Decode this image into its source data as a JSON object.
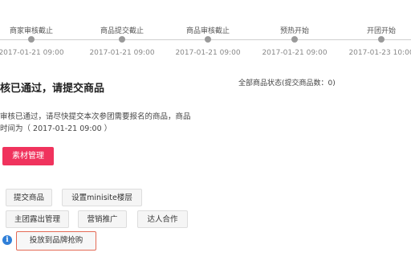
{
  "timeline": {
    "steps": [
      {
        "label": "商家审核截止",
        "date": "2017-01-21 09:00"
      },
      {
        "label": "商品提交截止",
        "date": "2017-01-21 09:00"
      },
      {
        "label": "商品审核截止",
        "date": "2017-01-21 09:00"
      },
      {
        "label": "预热开始",
        "date": "2017-01-21 09:00"
      },
      {
        "label": "开团开始",
        "date": "2017-01-23 10:00"
      }
    ]
  },
  "status": {
    "title": "核已通过，请提交商品",
    "summary": "全部商品状态(提交商品数：0)",
    "desc_line1": "审核已通过，请尽快提交本次参团需要报名的商品，商品",
    "desc_line2": "时间为（ 2017-01-21 09:00 ）"
  },
  "actions": {
    "material_button": "素材管理",
    "submit_goods": "提交商品",
    "minisite_floor": "设置minisite楼层",
    "main_exposure": "主团露出管理",
    "marketing": "营销推广",
    "influencer": "达人合作",
    "brand_flash": "投放到品牌抢购"
  },
  "icons": {
    "info": "info-icon"
  },
  "colors": {
    "accent": "#f0335d",
    "highlight_border": "#e46a55",
    "info_blue": "#2f7fd8"
  }
}
